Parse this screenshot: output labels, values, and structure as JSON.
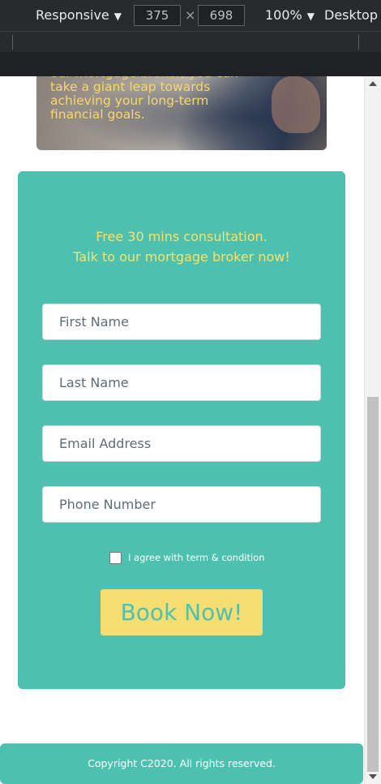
{
  "devtools": {
    "device_mode": "Responsive",
    "width": "375",
    "times": "×",
    "height": "698",
    "zoom": "100%",
    "device_type": "Desktop",
    "caret": "▼"
  },
  "hero": {
    "text": "our mortgage broker, you can take a giant leap towards achieving your long-term financial goals."
  },
  "form": {
    "intro_line1": "Free 30 mins consultation.",
    "intro_line2": "Talk to our mortgage broker now!",
    "first_name_placeholder": "First Name",
    "last_name_placeholder": "Last Name",
    "email_placeholder": "Email Address",
    "phone_placeholder": "Phone Number",
    "agree_label": "I agree with term & condition",
    "submit_label": "Book Now!"
  },
  "footer": {
    "copyright": "Copyright C2020. All rights reserved."
  },
  "colors": {
    "accent": "#4ec0b0",
    "highlight": "#f6de72"
  }
}
